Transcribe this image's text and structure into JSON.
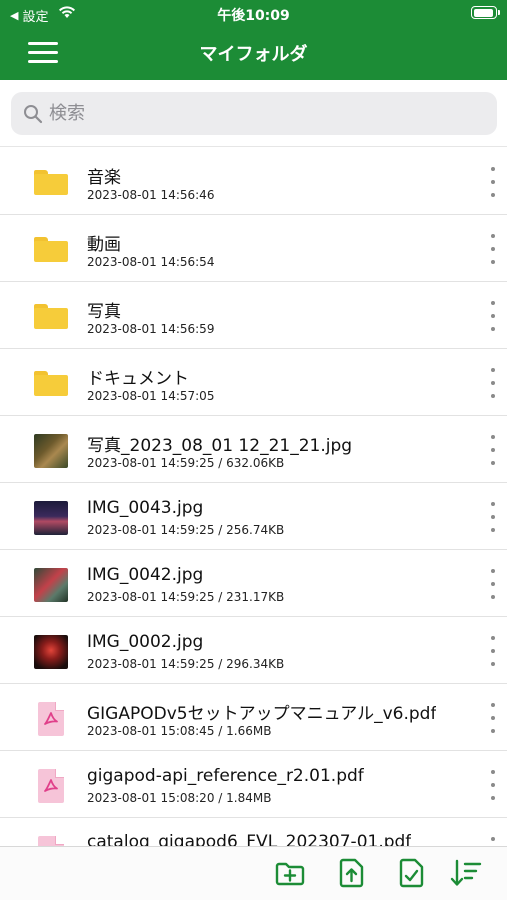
{
  "status_bar": {
    "back_label": "設定",
    "time": "午後10:09",
    "battery_level": 0.95
  },
  "nav": {
    "title": "マイフォルダ"
  },
  "search": {
    "placeholder": "検索"
  },
  "colors": {
    "brand_green": "#1c8c36",
    "folder_yellow": "#f6cc3a",
    "pdf_pink": "#f6c4d8"
  },
  "files": [
    {
      "name": "音楽",
      "meta": "2023-08-01 14:56:46",
      "kind": "folder"
    },
    {
      "name": "動画",
      "meta": "2023-08-01 14:56:54",
      "kind": "folder"
    },
    {
      "name": "写真",
      "meta": "2023-08-01 14:56:59",
      "kind": "folder"
    },
    {
      "name": "ドキュメント",
      "meta": "2023-08-01 14:57:05",
      "kind": "folder"
    },
    {
      "name": "写真_2023_08_01 12_21_21.jpg",
      "meta": "2023-08-01 14:59:25 / 632.06KB",
      "kind": "image"
    },
    {
      "name": "IMG_0043.jpg",
      "meta": "2023-08-01 14:59:25 / 256.74KB",
      "kind": "image"
    },
    {
      "name": "IMG_0042.jpg",
      "meta": "2023-08-01 14:59:25 / 231.17KB",
      "kind": "image"
    },
    {
      "name": "IMG_0002.jpg",
      "meta": "2023-08-01 14:59:25 / 296.34KB",
      "kind": "image"
    },
    {
      "name": "GIGAPODv5セットアップマニュアル_v6.pdf",
      "meta": "2023-08-01 15:08:45 / 1.66MB",
      "kind": "pdf"
    },
    {
      "name": "gigapod-api_reference_r2.01.pdf",
      "meta": "2023-08-01 15:08:20 / 1.84MB",
      "kind": "pdf"
    },
    {
      "name": "catalog_gigapod6_FVL_202307-01.pdf",
      "meta": "",
      "kind": "pdf"
    }
  ],
  "toolbar": {
    "buttons": [
      "new-folder-icon",
      "upload-icon",
      "select-icon",
      "sort-icon"
    ]
  }
}
